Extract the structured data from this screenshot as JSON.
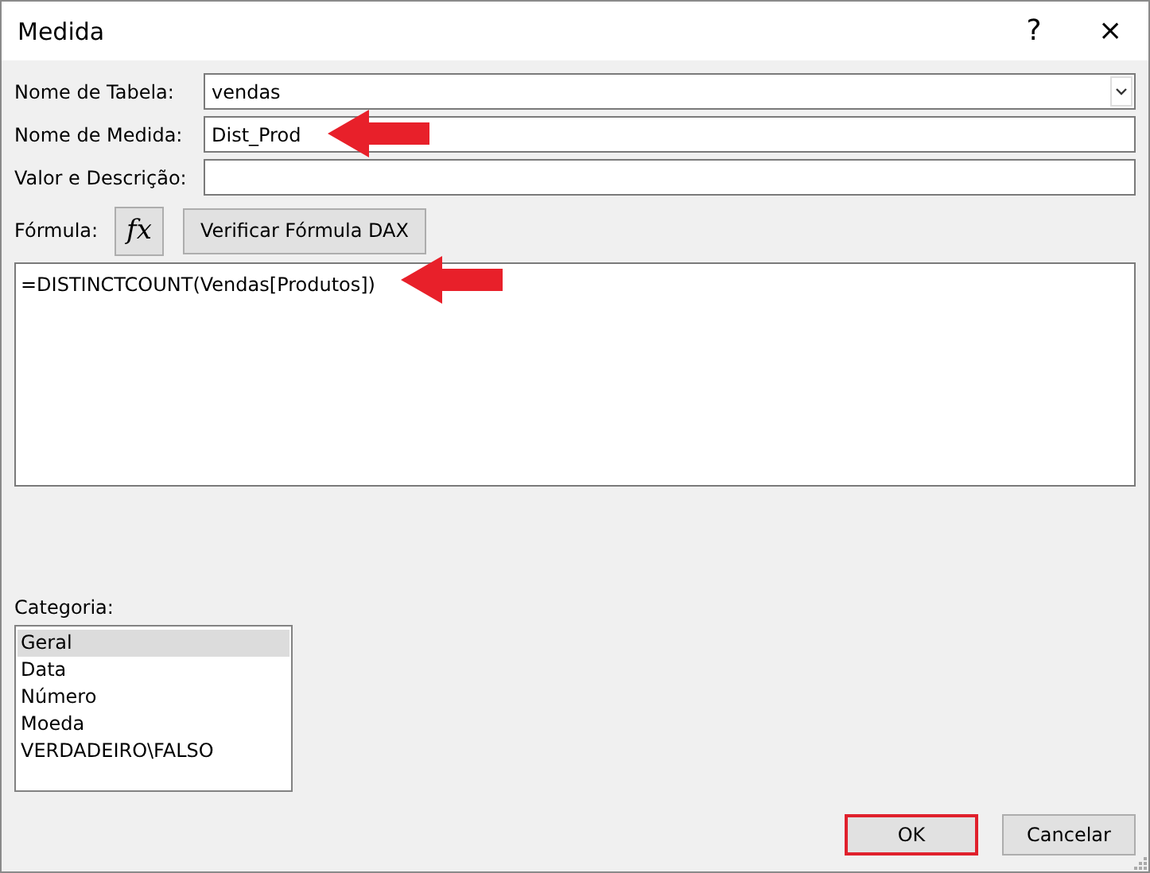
{
  "window": {
    "title": "Medida",
    "help": "?",
    "close": "×"
  },
  "fields": [
    {
      "kind": "dropdown",
      "label": "Nome de Tabela:",
      "value": "vendas",
      "marked": false
    },
    {
      "kind": "text",
      "label": "Nome de Medida:",
      "value": "Dist_Prod",
      "marked": true
    },
    {
      "kind": "text",
      "label": "Valor e Descrição:",
      "marked": false
    }
  ],
  "formula": {
    "label": "Fórmula:",
    "fx": "fx",
    "check_button": "Verificar Fórmula DAX",
    "value": "=DISTINCTCOUNT(Vendas[Produtos])",
    "marked": true
  },
  "category": {
    "label": "Categoria:",
    "items": [
      {
        "label": "Geral",
        "selected": true
      },
      {
        "label": "Data",
        "selected": false
      },
      {
        "label": "Número",
        "selected": false
      },
      {
        "label": "Moeda",
        "selected": false
      },
      {
        "label": "VERDADEIRO\\FALSO",
        "selected": false
      }
    ]
  },
  "buttons": [
    {
      "label": "OK",
      "highlighted": true
    },
    {
      "label": "Cancelar",
      "highlighted": false
    }
  ]
}
